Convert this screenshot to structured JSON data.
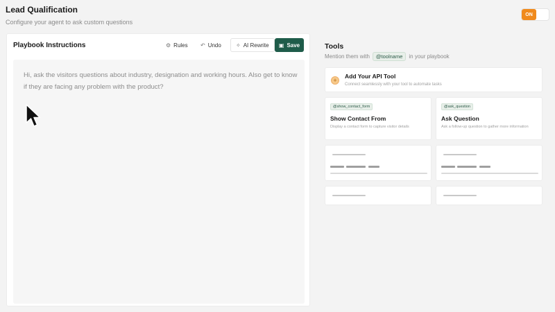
{
  "header": {
    "title": "Lead Qualification",
    "subtitle": "Configure your agent to ask custom questions",
    "toggle_label": "ON"
  },
  "playbook": {
    "title": "Playbook Instructions",
    "toolbar": {
      "rules_label": "Rules",
      "undo_label": "Undo",
      "ai_rewrite_label": "AI Rewrite",
      "save_label": "Save"
    },
    "editor_text": "Hi, ask the visitors questions about industry, designation and working hours. Also get to know if they are facing any problem with the product?"
  },
  "tools": {
    "title": "Tools",
    "subtitle_prefix": "Mention them with",
    "subtitle_tag": "@toolname",
    "subtitle_suffix": "in your playbook",
    "api_card": {
      "title": "Add Your API Tool",
      "description": "Connect seamlessly with your tool to automate tasks"
    },
    "cards": [
      {
        "tag": "@show_contact_form",
        "title": "Show Contact From",
        "description": "Display a contact form to capture visitor details"
      },
      {
        "tag": "@ask_question",
        "title": "Ask Question",
        "description": "Ask a follow-up question to gather more information"
      }
    ]
  },
  "colors": {
    "accent_green": "#1f5c4a",
    "toggle_orange": "#f08a1c",
    "background": "#f3f3f3"
  }
}
